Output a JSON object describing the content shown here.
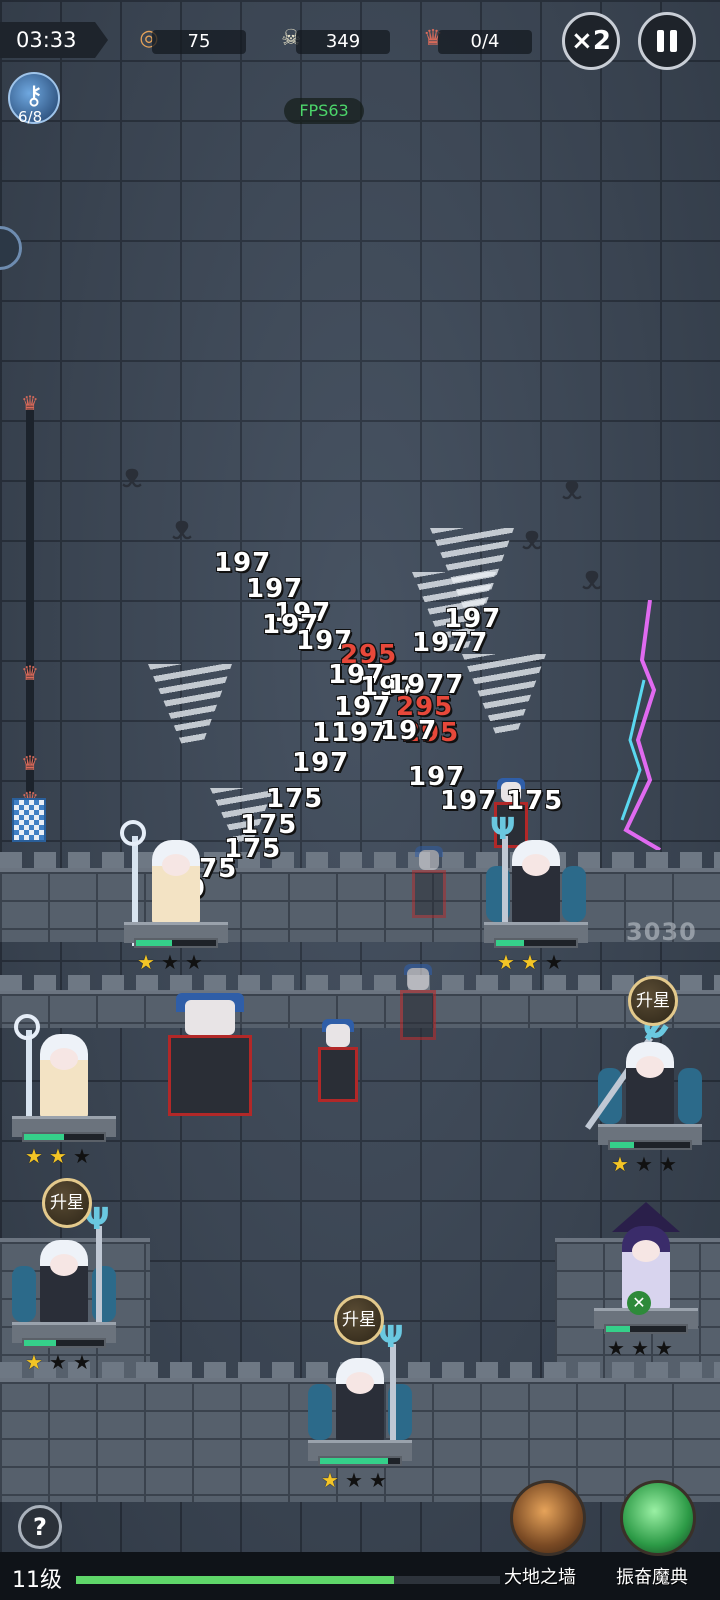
{
  "top_bar": {
    "timer": "03:33",
    "coins": "75",
    "kills": "349",
    "bosses": "0/4",
    "speed_label": "×2",
    "icons": {
      "coin": "coin-icon",
      "skull": "skull-icon",
      "boss": "demon-head-icon"
    }
  },
  "skill_charges": "6/8",
  "fps": "FPS63",
  "damage_numbers": [
    {
      "text": "197",
      "crit": false
    },
    {
      "text": "197",
      "crit": false
    },
    {
      "text": "197",
      "crit": false
    },
    {
      "text": "197",
      "crit": false
    },
    {
      "text": "197",
      "crit": false
    },
    {
      "text": "295",
      "crit": true
    },
    {
      "text": "197",
      "crit": false
    },
    {
      "text": "197",
      "crit": false
    },
    {
      "text": "197",
      "crit": false
    },
    {
      "text": "1977",
      "crit": false
    },
    {
      "text": "1977",
      "crit": false
    },
    {
      "text": "1197",
      "crit": false
    },
    {
      "text": "295",
      "crit": true
    },
    {
      "text": "197",
      "crit": false
    },
    {
      "text": "175",
      "crit": false
    },
    {
      "text": "197",
      "crit": false
    },
    {
      "text": "295",
      "crit": true
    },
    {
      "text": "197",
      "crit": false
    },
    {
      "text": "197",
      "crit": false
    },
    {
      "text": "197",
      "crit": false
    },
    {
      "text": "175",
      "crit": false
    },
    {
      "text": "175",
      "crit": false
    },
    {
      "text": "175",
      "crit": false
    },
    {
      "text": "175",
      "crit": false
    },
    {
      "text": "19",
      "crit": false
    }
  ],
  "ghost_value": "3030",
  "heroes": [
    {
      "id": "mage-top-left",
      "type": "mage",
      "stars": 1,
      "hp": 0.45
    },
    {
      "id": "dark-top-right",
      "type": "dark",
      "stars": 2,
      "hp": 0.35
    },
    {
      "id": "mage-mid-left",
      "type": "mage",
      "stars": 2,
      "hp": 0.5
    },
    {
      "id": "dark-mid-right",
      "type": "dark",
      "stars": 1,
      "hp": 0.3
    },
    {
      "id": "dark-low-left",
      "type": "dark",
      "stars": 1,
      "hp": 0.4
    },
    {
      "id": "witch-low-right",
      "type": "witch",
      "stars": 0,
      "hp": 0.3
    },
    {
      "id": "dark-bottom-center",
      "type": "dark",
      "stars": 1,
      "hp": 0.85
    }
  ],
  "upgrade_label": "升星",
  "bottom": {
    "help": "?",
    "level": "11级",
    "xp": 0.75,
    "skill1": "大地之墙",
    "skill2": "振奋魔典"
  },
  "colors": {
    "hp": "#35d08a",
    "xp": "#5fd66a",
    "fps": "#4cd66a",
    "crit": "#e8483a",
    "star": "#f4c526"
  }
}
